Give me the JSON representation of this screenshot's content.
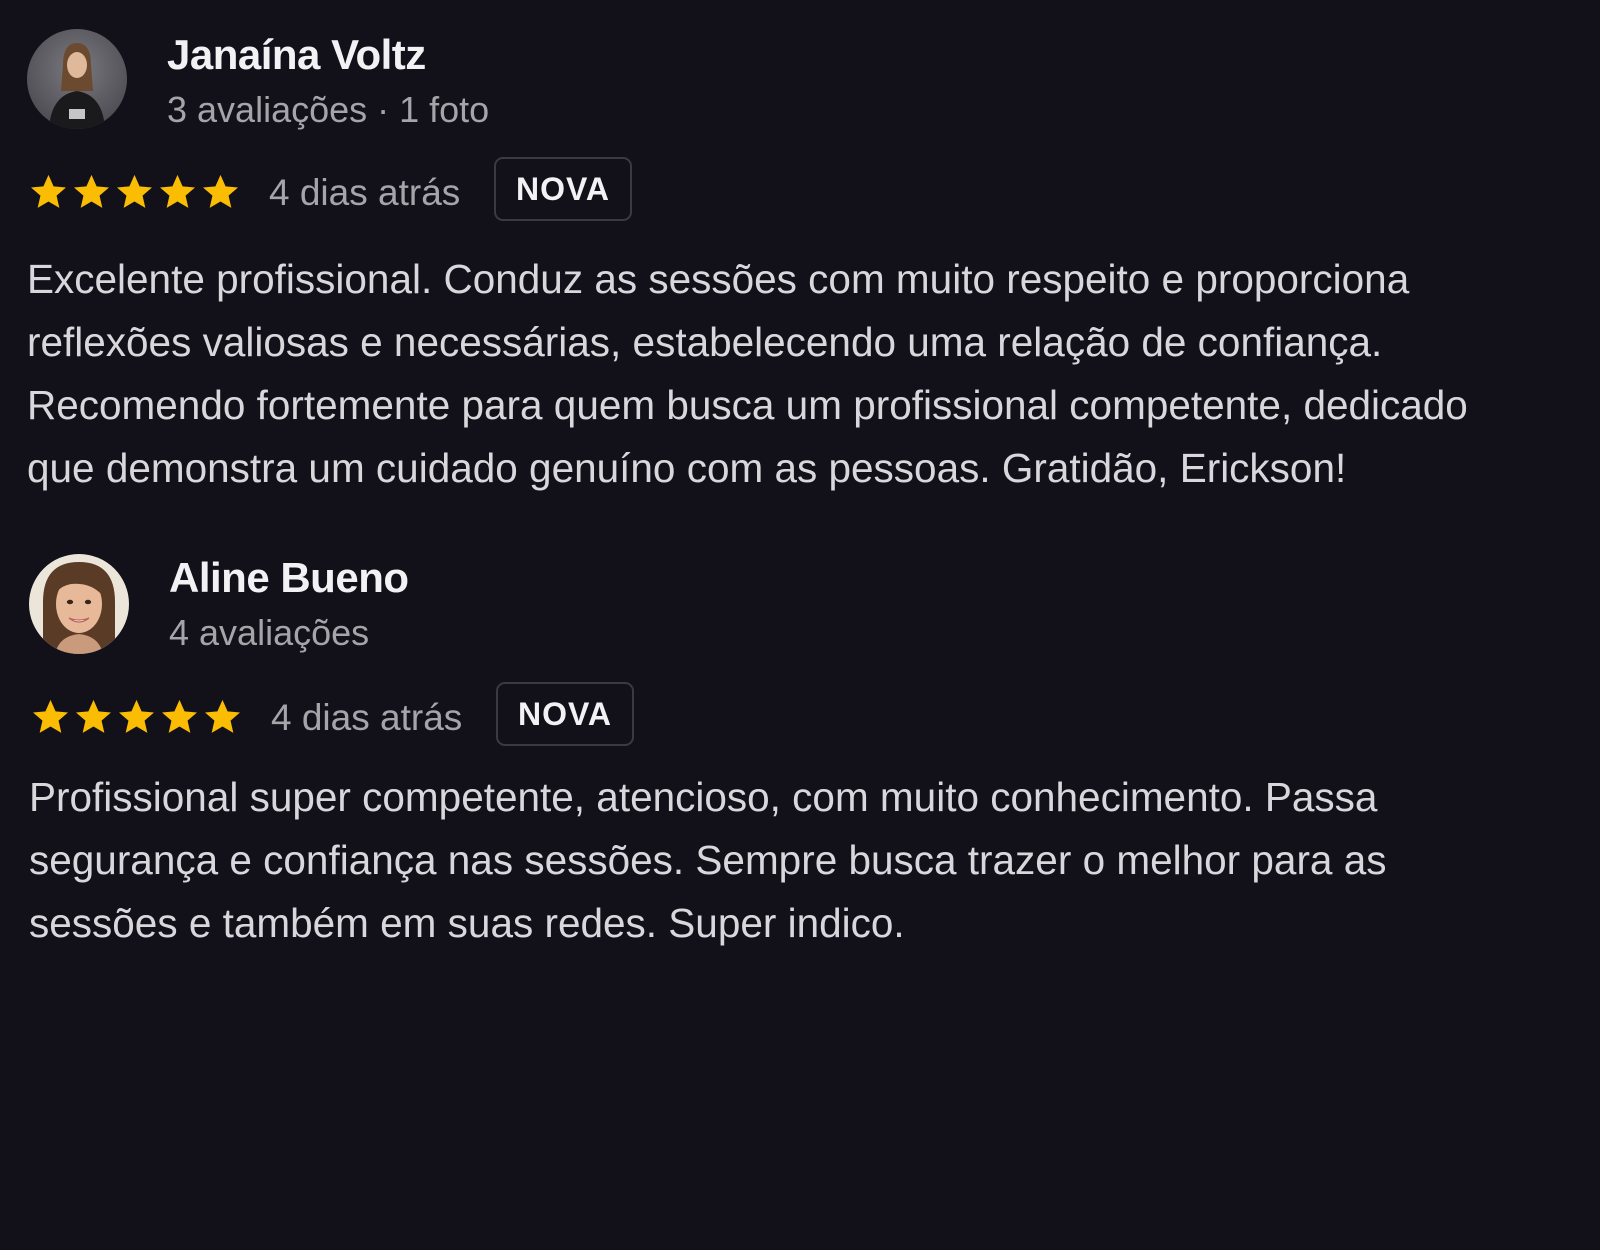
{
  "reviews": [
    {
      "name": "Janaína Voltz",
      "meta": "3 avaliações · 1 foto",
      "rating": 5,
      "rating_max": 5,
      "date": "4 dias atrás",
      "badge": "NOVA",
      "text_lines": [
        "Excelente profissional. Conduz as sessões com muito respeito e proporciona",
        "reflexões valiosas e necessárias, estabelecendo uma relação de confiança.",
        "Recomendo fortemente para quem busca um profissional competente, dedicado",
        "que demonstra um cuidado genuíno com as pessoas. Gratidão, Erickson!"
      ],
      "avatar_icon": "avatar-photo-icon"
    },
    {
      "name": "Aline Bueno",
      "meta": "4 avaliações",
      "rating": 5,
      "rating_max": 5,
      "date": "4 dias atrás",
      "badge": "NOVA",
      "text_lines": [
        "Profissional super competente, atencioso, com muito conhecimento. Passa",
        "segurança e confiança nas sessões. Sempre busca trazer o melhor para as",
        "sessões e também em suas redes. Super indico."
      ],
      "avatar_icon": "avatar-photo-icon"
    }
  ],
  "colors": {
    "background": "#12111a",
    "star": "#fbbc04",
    "muted_text": "#a4a4a9",
    "badge_border": "#3a3a42"
  }
}
